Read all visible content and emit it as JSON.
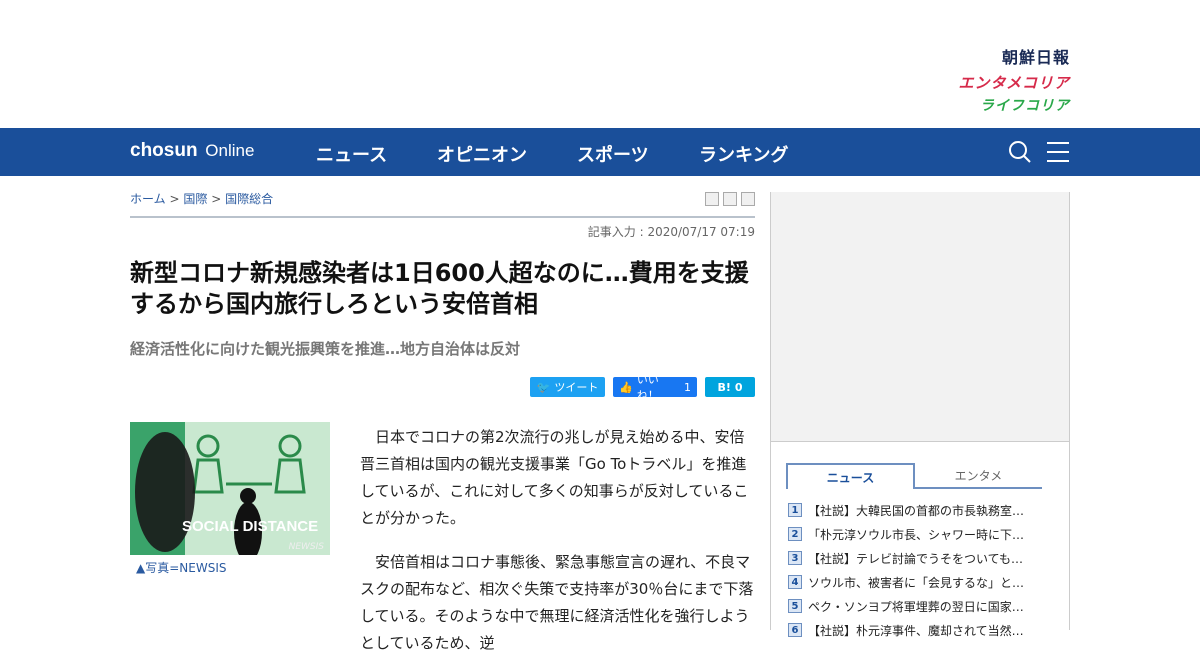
{
  "brands": {
    "chosun_ilbo": "朝鮮日報",
    "entame_korea": "エンタメコリア",
    "life_korea": "ライフコリア"
  },
  "nav": {
    "logo_bold": "chosun",
    "logo_light": "Online",
    "items": [
      "ニュース",
      "オピニオン",
      "スポーツ",
      "ランキング"
    ],
    "icons": [
      "search-icon",
      "menu-icon"
    ],
    "color": "#1a4f9a"
  },
  "breadcrumb": {
    "home": "ホーム",
    "sep": ">",
    "section": "国際",
    "subsection": "国際総合"
  },
  "article": {
    "date": "記事入力 : 2020/07/17 07:19",
    "title": "新型コロナ新規感染者は1日600人超なのに…費用を支援するから国内旅行しろという安倍首相",
    "subtitle": "経済活性化に向けた観光振興策を推進…地方自治体は反対",
    "photo_caption": "▲写真=NEWSIS",
    "photo_text": "SOCIAL DISTANCE",
    "photo_watermark": "NEWSIS",
    "p1": "日本でコロナの第2次流行の兆しが見え始める中、安倍晋三首相は国内の観光支援事業「Go Toトラベル」を推進しているが、これに対して多くの知事らが反対していることが分かった。",
    "p2_first": "安倍首相はコロナ事態後、緊急事態宣言の遅れ、不良マスクの配布など、相次ぐ失策で支持率が30％台にまで下落している。そのような中で無理に経済活性化を強行しようとしているため、逆"
  },
  "share": {
    "tweet": "ツイート",
    "like": "いいね！",
    "like_count": "1",
    "hatena": "B!",
    "hatena_count": "0"
  },
  "sidebar": {
    "tabs": [
      "ニュース",
      "エンタメ"
    ],
    "items": [
      {
        "n": "1",
        "text": "【社説】大韓民国の首都の市長執務室…"
      },
      {
        "n": "2",
        "text": "「朴元淳ソウル市長、シャワー時に下…"
      },
      {
        "n": "3",
        "text": "【社説】テレビ討論でうそをついても…"
      },
      {
        "n": "4",
        "text": "ソウル市、被害者に「会見するな」と…"
      },
      {
        "n": "5",
        "text": "ペク・ソンヨプ将軍埋葬の翌日に国家…"
      },
      {
        "n": "6",
        "text": "【社説】朴元淳事件、魔却されて当然…"
      }
    ]
  }
}
